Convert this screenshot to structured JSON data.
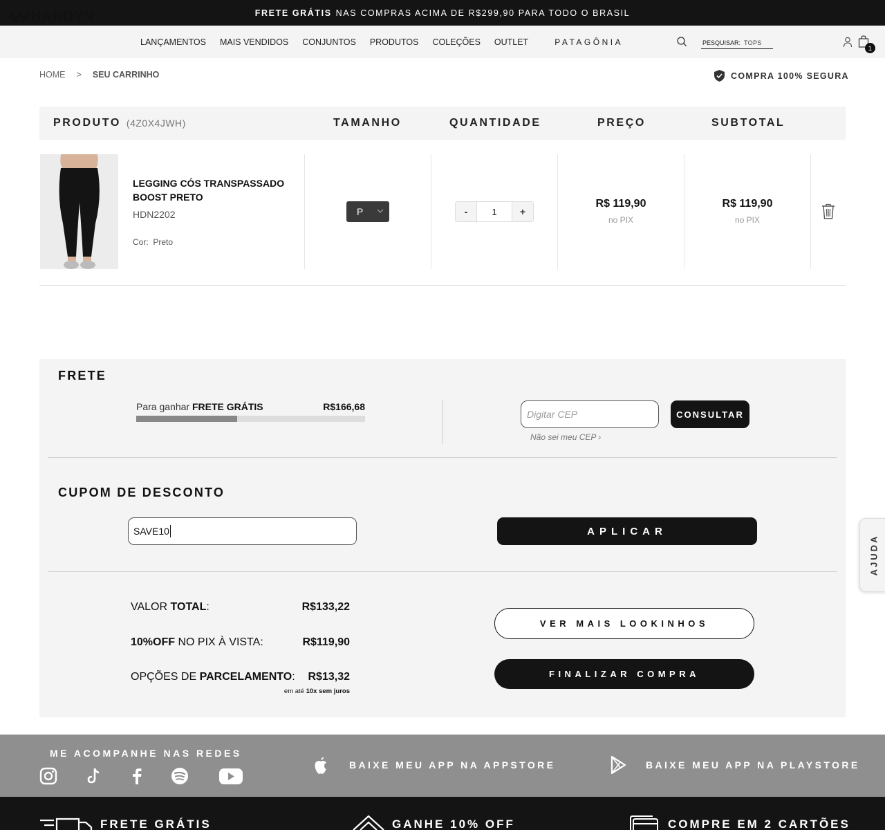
{
  "topbar": {
    "bold": "FRETE GRÁTIS",
    "rest": "NAS COMPRAS ACIMA DE R$299,90 PARA TODO O BRASIL"
  },
  "header": {
    "logo": "HARDYN",
    "nav": [
      "LANÇAMENTOS",
      "MAIS VENDIDOS",
      "CONJUNTOS",
      "PRODUTOS",
      "COLEÇÕES",
      "OUTLET"
    ],
    "nav_special": "PATAGÔNIA",
    "search_label": "PESQUISAR:",
    "search_placeholder": "TOPS",
    "cart_count": "1"
  },
  "breadcrumb": {
    "home": "HOME",
    "sep": ">",
    "current": "SEU CARRINHO"
  },
  "secure_label": "COMPRA 100% SEGURA",
  "table": {
    "product_header": "PRODUTO",
    "cart_code": "(4Z0X4JWH)",
    "size_header": "TAMANHO",
    "qty_header": "QUANTIDADE",
    "price_header": "PREÇO",
    "subtotal_header": "SUBTOTAL"
  },
  "item": {
    "name": "LEGGING CÓS TRANSPASSADO BOOST PRETO",
    "sku": "HDN2202",
    "color_label": "Cor:",
    "color_value": "Preto",
    "size": "P",
    "qty": "1",
    "minus": "-",
    "plus": "+",
    "price": "R$ 119,90",
    "price_note": "no PIX",
    "subtotal": "R$ 119,90",
    "subtotal_note": "no PIX"
  },
  "frete": {
    "title": "FRETE",
    "progress_prefix": "Para ganhar",
    "progress_bold": "FRETE GRÁTIS",
    "remaining": "R$166,68",
    "progress_pct": 44,
    "cep_placeholder": "Digitar CEP",
    "consultar": "CONSULTAR",
    "cep_help": "Não sei meu CEP ›"
  },
  "cupom": {
    "title": "CUPOM DE DESCONTO",
    "value": "SAVE10",
    "apply": "APLICAR"
  },
  "summary": {
    "total_prefix": "VALOR",
    "total_bold": "TOTAL",
    "total_suffix": ":",
    "total_value": "R$133,22",
    "pix_bold": "10%OFF",
    "pix_rest": "NO PIX À VISTA:",
    "pix_value": "R$119,90",
    "parc_prefix": "OPÇÕES DE",
    "parc_bold": "PARCELAMENTO",
    "parc_suffix": ":",
    "parc_value": "R$13,32",
    "parc_note_prefix": "em até",
    "parc_note_bold": "10x",
    "parc_note_bold2": "sem juros",
    "more_looks": "VER MAIS LOOKINHOS",
    "checkout": "FINALIZAR COMPRA"
  },
  "ajuda": "AJUDA",
  "social": {
    "title": "ME ACOMPANHE NAS REDES",
    "icons": [
      "instagram-icon",
      "tiktok-icon",
      "facebook-icon",
      "spotify-icon",
      "youtube-icon"
    ],
    "appstore": "BAIXE MEU APP NA APPSTORE",
    "playstore": "BAIXE MEU APP NA PLAYSTORE"
  },
  "footer": {
    "f1": "FRETE GRÁTIS",
    "f2": "GANHE 10% OFF",
    "f3": "COMPRE EM 2 CARTÕES"
  },
  "colors": {
    "dark": "#141414",
    "panel": "#f4f4f4",
    "social_band": "#8f8f8f"
  }
}
